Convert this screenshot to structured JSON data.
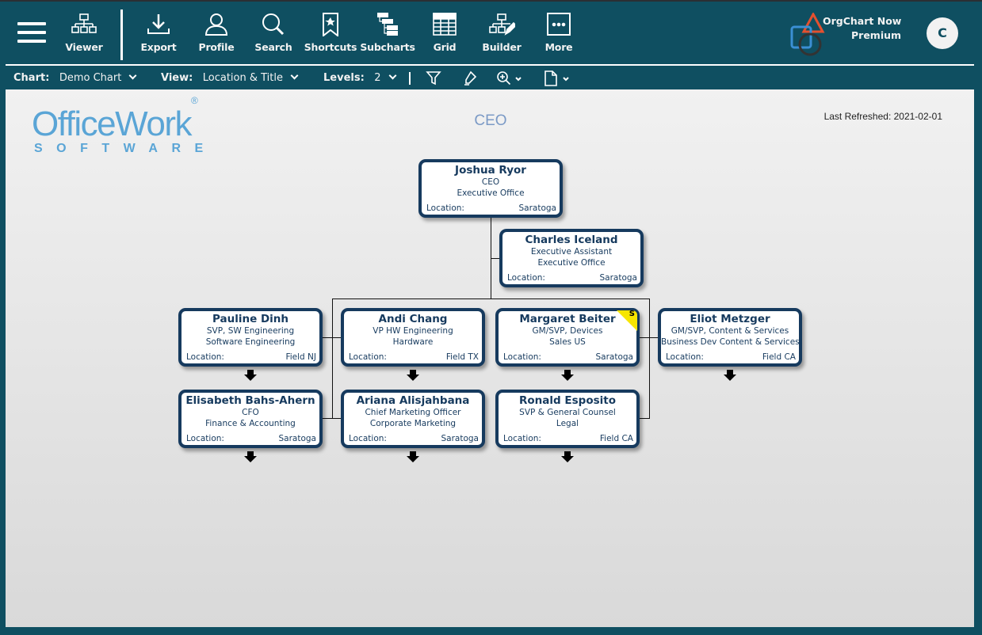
{
  "toolbar": {
    "menu_icon": "hamburger-menu-icon",
    "items": [
      {
        "label": "Viewer",
        "icon": "org-chart-icon"
      },
      {
        "label": "Export",
        "icon": "download-icon"
      },
      {
        "label": "Profile",
        "icon": "user-icon"
      },
      {
        "label": "Search",
        "icon": "search-icon"
      },
      {
        "label": "Shortcuts",
        "icon": "bookmark-star-icon"
      },
      {
        "label": "Subcharts",
        "icon": "subcharts-icon"
      },
      {
        "label": "Grid",
        "icon": "grid-icon"
      },
      {
        "label": "Builder",
        "icon": "builder-icon"
      },
      {
        "label": "More",
        "icon": "more-icon"
      }
    ],
    "brand": {
      "name": "OrgChart Now",
      "tier": "Premium"
    },
    "avatar_initial": "C"
  },
  "subbar": {
    "chart_label": "Chart:",
    "chart_value": "Demo Chart",
    "view_label": "View:",
    "view_value": "Location & Title",
    "levels_label": "Levels:",
    "levels_value": "2",
    "icons": [
      "filter-icon",
      "highlighter-icon",
      "zoom-icon",
      "page-icon"
    ]
  },
  "canvas": {
    "logo_main": "OfficeWork",
    "logo_reg": "®",
    "logo_sub": "SOFTWARE",
    "chart_title": "CEO",
    "last_refreshed": "Last Refreshed: 2021-02-01"
  },
  "cards": [
    {
      "name": "Joshua Ryor",
      "title": "CEO",
      "dept": "Executive Office",
      "loc_label": "Location:",
      "loc": "Saratoga"
    },
    {
      "name": "Charles Iceland",
      "title": "Executive Assistant",
      "dept": "Executive Office",
      "loc_label": "Location:",
      "loc": "Saratoga"
    },
    {
      "name": "Pauline Dinh",
      "title": "SVP, SW Engineering",
      "dept": "Software Engineering",
      "loc_label": "Location:",
      "loc": "Field NJ"
    },
    {
      "name": "Andi Chang",
      "title": "VP HW Engineering",
      "dept": "Hardware",
      "loc_label": "Location:",
      "loc": "Field TX"
    },
    {
      "name": "Margaret Beiter",
      "title": "GM/SVP, Devices",
      "dept": "Sales US",
      "loc_label": "Location:",
      "loc": "Saratoga",
      "badge": "S"
    },
    {
      "name": "Eliot Metzger",
      "title": "GM/SVP, Content & Services",
      "dept": "Business Dev Content & Services",
      "loc_label": "Location:",
      "loc": "Field CA"
    },
    {
      "name": "Elisabeth Bahs-Ahern",
      "title": "CFO",
      "dept": "Finance & Accounting",
      "loc_label": "Location:",
      "loc": "Saratoga"
    },
    {
      "name": "Ariana Alisjahbana",
      "title": "Chief Marketing Officer",
      "dept": "Corporate Marketing",
      "loc_label": "Location:",
      "loc": "Saratoga"
    },
    {
      "name": "Ronald Esposito",
      "title": "SVP & General Counsel",
      "dept": "Legal",
      "loc_label": "Location:",
      "loc": "Field CA"
    }
  ]
}
